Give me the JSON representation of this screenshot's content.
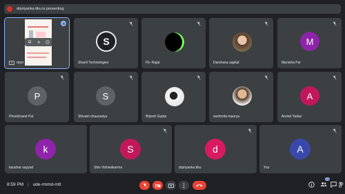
{
  "banner": {
    "text": "drpriyanka tiku is presenting",
    "avatar_letter": "d"
  },
  "presentation": {
    "label": "drpri"
  },
  "participants": [
    {
      "name": "Shanil Technologies",
      "initial": "S",
      "color": "#202124"
    },
    {
      "name": "Fb- Rajat"
    },
    {
      "name": "Darshana sapkal"
    },
    {
      "name": "Manisha Pai",
      "initial": "M",
      "color": "#8e24aa"
    },
    {
      "name": "Phoolchand Pal",
      "initial": "P",
      "color": "#5f6368"
    },
    {
      "name": "Shivam chaurasiya",
      "initial": "S",
      "color": "#5f6368"
    },
    {
      "name": "Brijesh Gupta"
    },
    {
      "name": "sushmita maurya"
    },
    {
      "name": "Arvind Yadav",
      "initial": "A",
      "color": "#c2185b"
    },
    {
      "name": "kaushar sayyad",
      "initial": "k",
      "color": "#8e24aa"
    },
    {
      "name": "Shiv Vishwakarma",
      "initial": "S",
      "color": "#c2185b"
    },
    {
      "name": "drpriyanka tiku",
      "initial": "d",
      "color": "#d81b60"
    },
    {
      "name": "You",
      "initial": "A",
      "color": "#3949ab"
    }
  ],
  "bottom_bar": {
    "time": "8:59 PM",
    "separator": "|",
    "meeting_code": "ude-rmmd-mtt",
    "participant_count": "14"
  },
  "icons": {
    "mic_off": "mic-off-icon",
    "camera_off": "videocam-off-icon",
    "present": "present-to-all-icon",
    "more": "more-vert-icon",
    "end_call": "call-end-icon",
    "info": "info-icon",
    "people": "people-icon",
    "chat": "chat-icon",
    "activities": "activities-icon"
  },
  "colors": {
    "background": "#202124",
    "tile": "#3c4043",
    "danger": "#ea4335",
    "accent": "#8ab4f8"
  }
}
